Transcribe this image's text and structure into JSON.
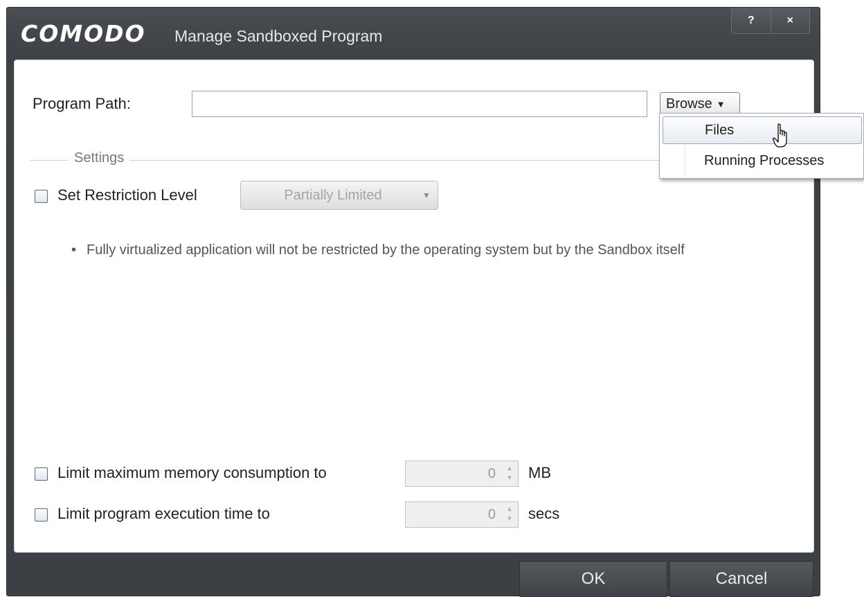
{
  "window": {
    "brand": "COMODO",
    "title": "Manage Sandboxed Program",
    "help_label": "?",
    "close_label": "×"
  },
  "program_path": {
    "label": "Program Path:",
    "value": "",
    "browse_label": "Browse",
    "browse_caret": "▼"
  },
  "settings": {
    "legend": "Settings",
    "restriction": {
      "label": "Set Restriction Level",
      "checked": false,
      "selected": "Partially Limited"
    },
    "note": {
      "bullet": "•",
      "text": "Fully virtualized application will not be restricted by the operating system but by the Sandbox itself"
    },
    "memory": {
      "label": "Limit maximum memory consumption to",
      "checked": false,
      "value": "0",
      "unit": "MB"
    },
    "execution": {
      "label": "Limit program execution time to",
      "checked": false,
      "value": "0",
      "unit": "secs"
    }
  },
  "buttons": {
    "ok": "OK",
    "cancel": "Cancel"
  },
  "browse_menu": {
    "items": [
      "Files",
      "Running Processes"
    ],
    "highlighted": "Files"
  },
  "colors": {
    "titlebar": "#434649",
    "panel": "#ffffff",
    "accent_border": "#8aa6c2"
  }
}
